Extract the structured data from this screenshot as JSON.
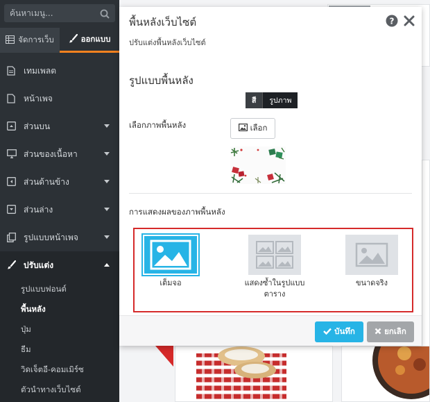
{
  "sidebar": {
    "search_placeholder": "ค้นหาเมนู...",
    "tabs": [
      {
        "label": "จัดการเว็บ",
        "icon": "table-icon"
      },
      {
        "label": "ออกแบบ",
        "icon": "brush-icon",
        "active": true
      }
    ],
    "items": [
      {
        "label": "เทมเพลต",
        "icon": "document-icon"
      },
      {
        "label": "หน้าเพจ",
        "icon": "file-icon"
      },
      {
        "label": "ส่วนบน",
        "icon": "caret-up-box-icon"
      },
      {
        "label": "ส่วนของเนื้อหา",
        "icon": "desktop-icon"
      },
      {
        "label": "ส่วนด้านข้าง",
        "icon": "caret-left-box-icon"
      },
      {
        "label": "ส่วนล่าง",
        "icon": "caret-down-box-icon"
      },
      {
        "label": "รูปแบบหน้าเพจ",
        "icon": "copy-icon"
      },
      {
        "label": "ปรับแต่ง",
        "icon": "brush-icon",
        "expanded": true
      }
    ],
    "sub_items": [
      {
        "label": "รูปแบบฟอนต์"
      },
      {
        "label": "พื้นหลัง",
        "active": true
      },
      {
        "label": "ปุ่ม"
      },
      {
        "label": "ธีม"
      },
      {
        "label": "วิดเจ็ตอี-คอมเมิร์ซ"
      },
      {
        "label": "ตัวนำทางเว็บไซต์"
      }
    ]
  },
  "modal": {
    "title": "พื้นหลังเว็บไซต์",
    "subtitle": "ปรับแต่งพื้นหลังเว็บไซต์",
    "section_title": "รูปแบบพื้นหลัง",
    "toggle": {
      "color_label": "สี",
      "image_label": "รูปภาพ"
    },
    "choose_image_label": "เลือกภาพพื้นหลัง",
    "choose_button": "เลือก",
    "display_label": "การแสดงผลของภาพพื้นหลัง",
    "options": [
      {
        "label": "เต็มจอ",
        "selected": true
      },
      {
        "label_line1": "แสดงซ้ำในรูปแบบ",
        "label_line2": "ตาราง"
      },
      {
        "label": "ขนาดจริง"
      }
    ],
    "save_button": "บันทึก",
    "cancel_button": "ยกเลิก"
  },
  "colors": {
    "accent": "#f6821f",
    "primary": "#27b4e6",
    "highlight": "#d52a2a",
    "sidebar_bg": "#2c3136"
  }
}
